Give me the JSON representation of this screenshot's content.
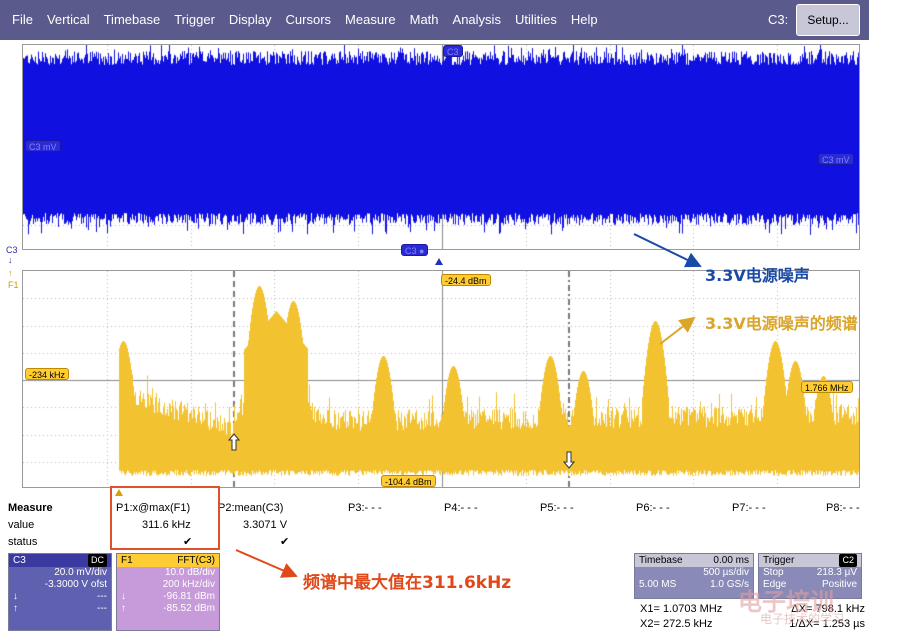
{
  "menubar": {
    "items": [
      "File",
      "Vertical",
      "Timebase",
      "Trigger",
      "Display",
      "Cursors",
      "Measure",
      "Math",
      "Analysis",
      "Utilities",
      "Help"
    ],
    "channel": "C3:",
    "setup_label": "Setup..."
  },
  "grid_top": {
    "trace_color": "#1010e0",
    "tag_top": "C3",
    "tag_left": "C3 mV",
    "tag_right": "C3 mV",
    "tag_bottom": "C3 ●"
  },
  "side_labels": {
    "c3": "C3",
    "f1": "F1"
  },
  "grid_bot": {
    "trace_color": "#f2c230",
    "tag_top": "-24.4 dBm",
    "tag_left": "-234 kHz",
    "tag_right": "1.766 MHz",
    "tag_bottom": "-104.4 dBm"
  },
  "annotations": {
    "noise": "3.3V电源噪声",
    "spectrum": "3.3V电源噪声的频谱",
    "max": "频谱中最大值在311.6kHz"
  },
  "measure": {
    "title": "Measure",
    "row_value": "value",
    "row_status": "status",
    "columns": [
      {
        "name": "P1:x@max(F1)",
        "value": "311.6 kHz",
        "status": "✔"
      },
      {
        "name": "P2:mean(C3)",
        "value": "3.3071 V",
        "status": "✔"
      },
      {
        "name": "P3:- - -",
        "value": "",
        "status": ""
      },
      {
        "name": "P4:- - -",
        "value": "",
        "status": ""
      },
      {
        "name": "P5:- - -",
        "value": "",
        "status": ""
      },
      {
        "name": "P6:- - -",
        "value": "",
        "status": ""
      },
      {
        "name": "P7:- - -",
        "value": "",
        "status": ""
      },
      {
        "name": "P8:- - -",
        "value": "",
        "status": ""
      }
    ]
  },
  "panel_c3": {
    "head": "C3",
    "badge": "DC",
    "vdiv": "20.0 mV/div",
    "offset": "-3.3000 V ofst",
    "r1": "---",
    "r2": "---"
  },
  "panel_f1": {
    "head": "F1",
    "func": "FFT(C3)",
    "dbdiv": "10.0 dB/div",
    "hzdiv": "200 kHz/div",
    "r1": "-96.81 dBm",
    "r2": "-85.52 dBm"
  },
  "panel_tb": {
    "title": "Timebase",
    "delay": "0.00 ms",
    "tdiv": "500 µs/div",
    "samples": "5.00 MS",
    "rate": "1.0 GS/s"
  },
  "panel_trig": {
    "title": "Trigger",
    "badge": "C2",
    "mode": "Stop",
    "level": "218.3 µV",
    "type": "Edge",
    "slope": "Positive"
  },
  "readout": {
    "x1_label": "X1=",
    "x1_value": "1.0703 MHz",
    "x2_label": "X2=",
    "x2_value": "272.5 kHz",
    "dx_label": "ΔX=",
    "dx_value": "798.1 kHz",
    "inv_dx": "1/ΔX= 1.253 µs"
  },
  "watermark": {
    "main": "电子培训",
    "sub": "电子技术的学习"
  }
}
